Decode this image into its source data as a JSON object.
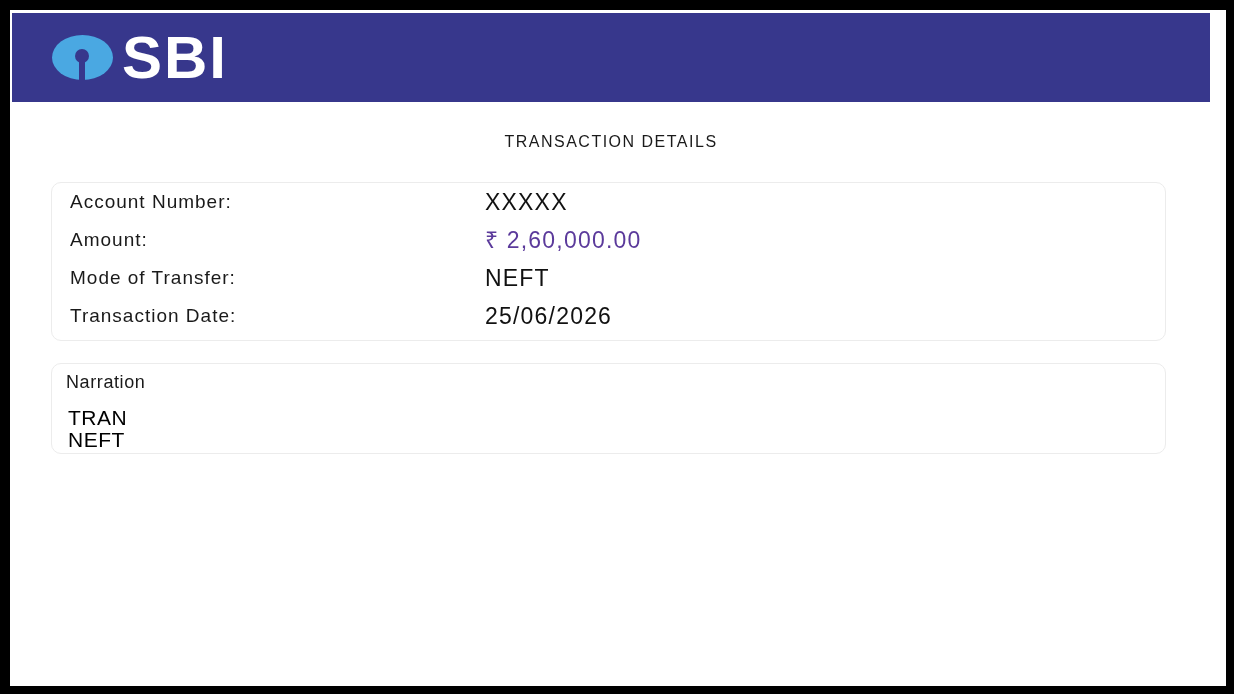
{
  "header": {
    "logo_text": "SBI"
  },
  "title": "TRANSACTION DETAILS",
  "details": [
    {
      "label": "Account Number:",
      "value": "XXXXX",
      "kind": "plain"
    },
    {
      "label": "Amount:",
      "value": "₹ 2,60,000.00",
      "kind": "amount"
    },
    {
      "label": "Mode of Transfer:",
      "value": "NEFT",
      "kind": "plain"
    },
    {
      "label": "Transaction Date:",
      "value": "25/06/2026",
      "kind": "plain"
    }
  ],
  "narration": {
    "label": "Narration",
    "lines": [
      "TRAN",
      "NEFT"
    ]
  }
}
